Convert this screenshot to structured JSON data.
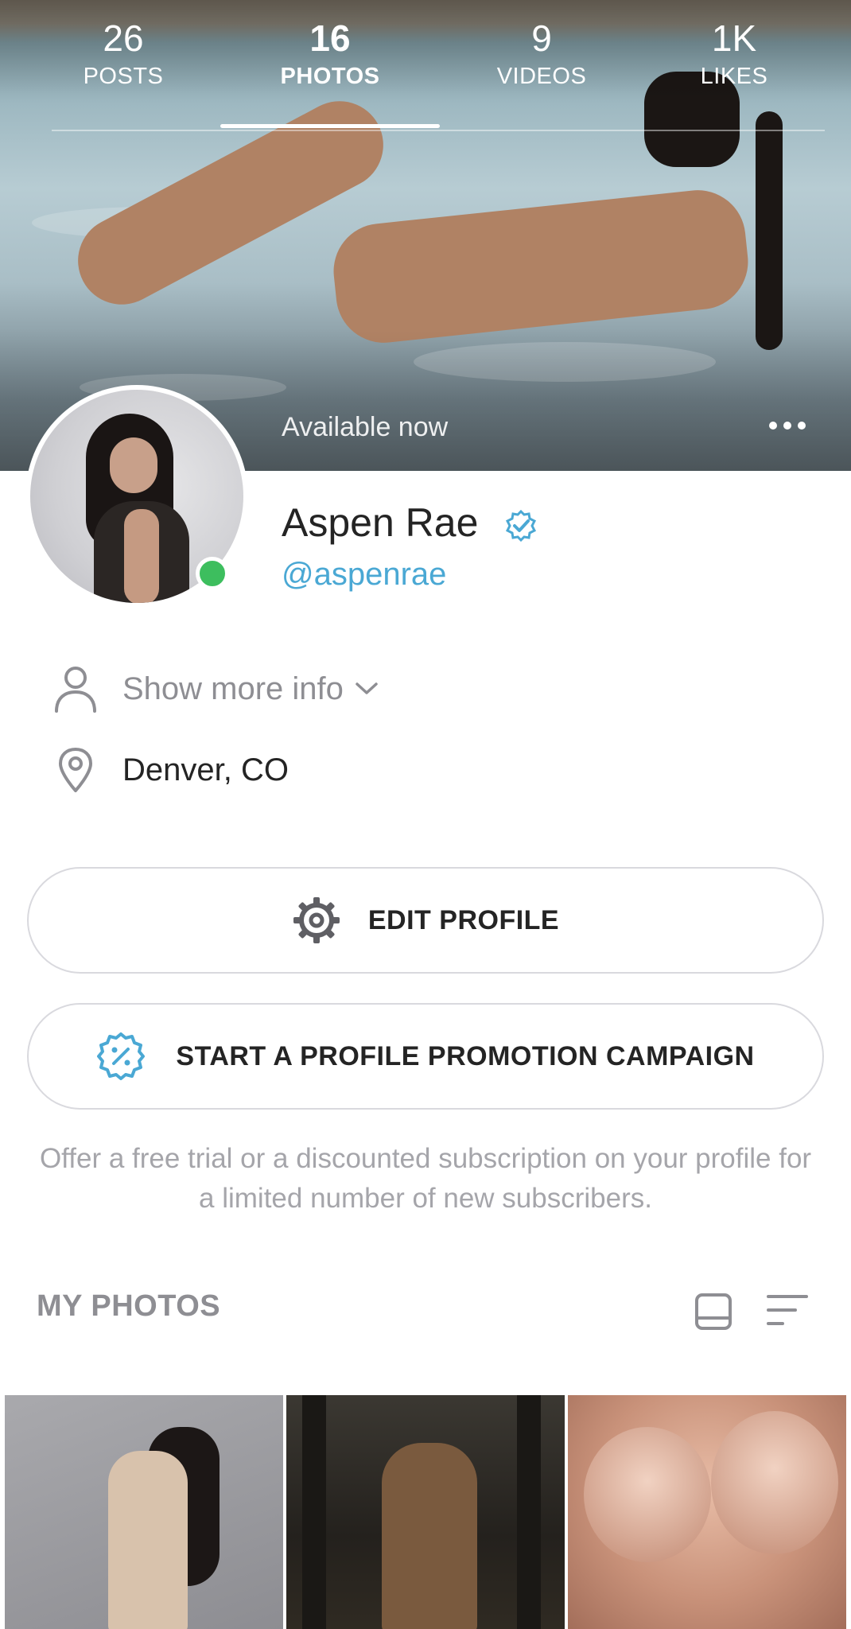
{
  "stats": [
    {
      "value": "26",
      "label": "POSTS"
    },
    {
      "value": "16",
      "label": "PHOTOS"
    },
    {
      "value": "9",
      "label": "VIDEOS"
    },
    {
      "value": "1K",
      "label": "LIKES"
    }
  ],
  "cover": {
    "status_text": "Available now",
    "more_icon": "more-horizontal-icon"
  },
  "profile": {
    "name": "Aspen Rae",
    "handle": "@aspenrae",
    "online": true
  },
  "info": {
    "show_more_label": "Show more info",
    "location": "Denver, CO"
  },
  "buttons": {
    "edit_profile": "EDIT PROFILE",
    "promotion": "START A PROFILE PROMOTION CAMPAIGN"
  },
  "promo_description": "Offer a free trial or a discounted subscription on your profile for a limited number of new subscribers.",
  "photos_section": {
    "title": "MY PHOTOS"
  },
  "colors": {
    "accent": "#4aa8d4",
    "online": "#3dbe5e",
    "muted": "#8e8e93"
  }
}
